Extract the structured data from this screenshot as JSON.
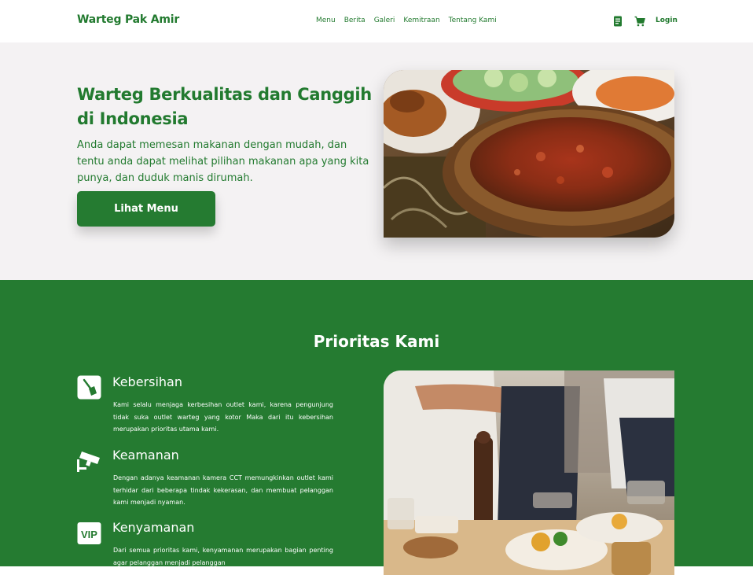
{
  "nav": {
    "brand": "Warteg Pak Amir",
    "menu": [
      "Menu",
      "Berita",
      "Galeri",
      "Kemitraan",
      "Tentang Kami"
    ],
    "icons": [
      "receipt-icon",
      "cart-icon"
    ],
    "login": "Login"
  },
  "hero": {
    "title": "Warteg Berkualitas dan Canggih di Indonesia",
    "description": "Anda dapat memesan makanan dengan mudah, dan tentu anda dapat melihat pilihan makanan apa yang kita punya, dan duduk manis dirumah.",
    "button": "Lihat Menu"
  },
  "priorities": {
    "title": "Prioritas Kami",
    "items": [
      {
        "icon": "broom-icon",
        "title": "Kebersihan",
        "description": "Kami selalu menjaga kerbesihan outlet kami, karena pengunjung tidak suka outlet warteg yang kotor Maka dari itu kebersihan merupakan prioritas utama kami."
      },
      {
        "icon": "cctv-camera-icon",
        "title": "Keamanan",
        "description": "Dengan adanya keamanan kamera CCT memungkinkan outlet kami terhidar dari beberapa tindak kekerasan, dan membuat pelanggan kami menjadi nyaman."
      },
      {
        "icon": "vip-icon",
        "title": "Kenyamanan",
        "description": "Dari semua prioritas kami, kenyamanan merupakan bagian penting agar pelanggan menjadi pelanggan"
      }
    ]
  },
  "colors": {
    "brand_green": "#257b31",
    "hero_bg": "#f4f2f3",
    "white": "#ffffff"
  }
}
